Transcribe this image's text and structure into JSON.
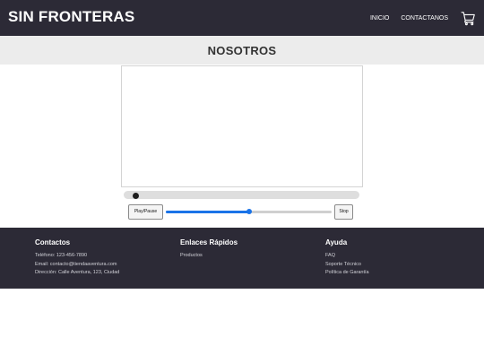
{
  "header": {
    "brand": "SIN FRONTERAS",
    "nav": [
      "INICIO",
      "CONTACTANOS"
    ],
    "cart_icon": "shopping-cart-icon"
  },
  "page": {
    "title": "NOSOTROS"
  },
  "player": {
    "seek_progress": 0.02,
    "play_pause_label": "Play/Pause",
    "stop_label": "Stop",
    "volume": 0.5,
    "accent_color": "#1a73e8"
  },
  "footer": {
    "contacts": {
      "title": "Contactos",
      "lines": [
        "Teléfono: 123-456-7890",
        "Email: contacto@tiendaaventura.com",
        "Dirección: Calle Aventura, 123, Ciudad"
      ]
    },
    "quick_links": {
      "title": "Enlaces Rápidos",
      "links": [
        "Productos"
      ]
    },
    "help": {
      "title": "Ayuda",
      "links": [
        "FAQ",
        "Soporte Técnico",
        "Política de Garantía"
      ]
    }
  },
  "colors": {
    "header_bg": "#2c2a36",
    "title_band_bg": "#ececec",
    "footer_bg": "#2c2a36"
  }
}
